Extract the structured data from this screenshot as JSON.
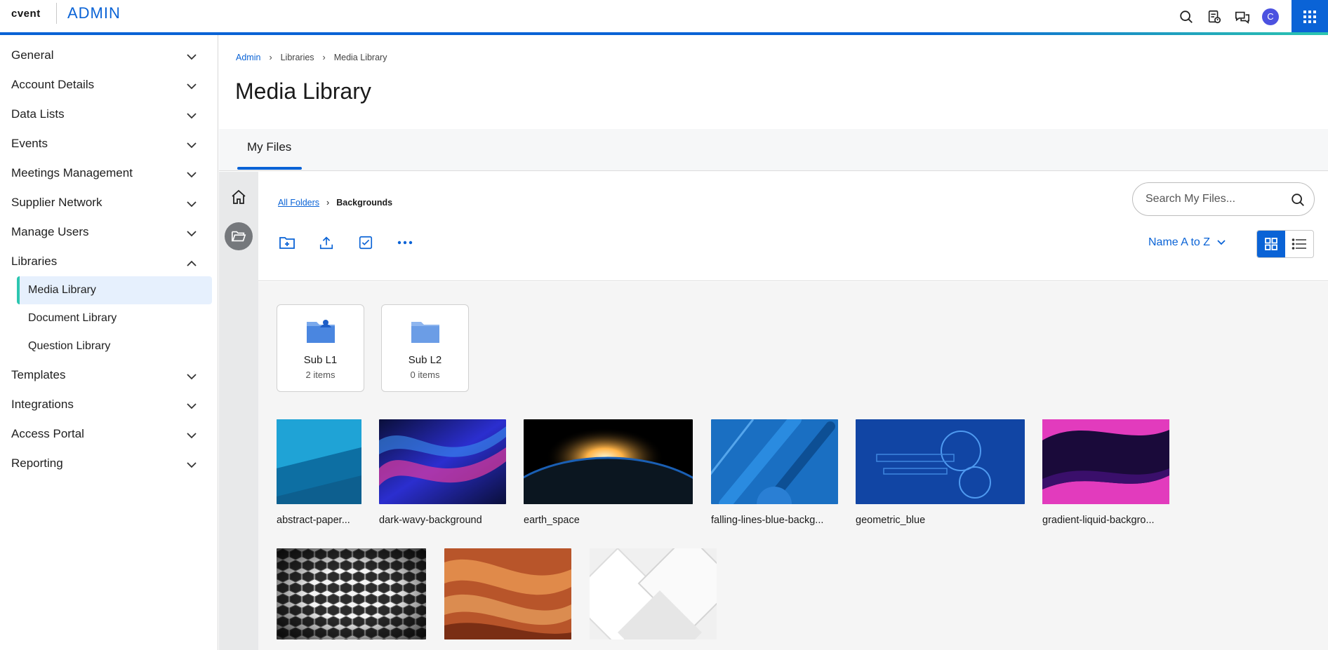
{
  "app": {
    "logo": "cvent",
    "title": "ADMIN"
  },
  "header": {
    "icons": [
      "search-icon",
      "calendar-list-icon",
      "chat-icon"
    ],
    "avatar_initial": "C"
  },
  "sidebar": {
    "items": [
      {
        "label": "General",
        "expanded": false
      },
      {
        "label": "Account Details",
        "expanded": false
      },
      {
        "label": "Data Lists",
        "expanded": false
      },
      {
        "label": "Events",
        "expanded": false
      },
      {
        "label": "Meetings Management",
        "expanded": false
      },
      {
        "label": "Supplier Network",
        "expanded": false
      },
      {
        "label": "Manage Users",
        "expanded": false
      },
      {
        "label": "Libraries",
        "expanded": true
      },
      {
        "label": "Templates",
        "expanded": false
      },
      {
        "label": "Integrations",
        "expanded": false
      },
      {
        "label": "Access Portal",
        "expanded": false
      },
      {
        "label": "Reporting",
        "expanded": false
      }
    ],
    "libraries_children": [
      {
        "label": "Media Library",
        "active": true
      },
      {
        "label": "Document Library",
        "active": false
      },
      {
        "label": "Question Library",
        "active": false
      }
    ]
  },
  "breadcrumb": [
    "Admin",
    "Libraries",
    "Media Library"
  ],
  "page_title": "Media Library",
  "tabs": [
    {
      "label": "My Files",
      "active": true
    }
  ],
  "folder_breadcrumb": {
    "root": "All Folders",
    "current": "Backgrounds"
  },
  "search": {
    "placeholder": "Search My Files..."
  },
  "sort": {
    "label": "Name A to Z"
  },
  "view_mode": "grid",
  "folders": [
    {
      "name": "Sub L1",
      "count": "2 items",
      "has_content": true
    },
    {
      "name": "Sub L2",
      "count": "0 items",
      "has_content": false
    }
  ],
  "images": [
    {
      "name": "abstract-paper...",
      "colors": [
        "#0a7fb8",
        "#1fa3d6",
        "#0d5f8f"
      ]
    },
    {
      "name": "dark-wavy-background",
      "colors": [
        "#2b2ecf",
        "#e03aa0",
        "#0a0f3a"
      ]
    },
    {
      "name": "earth_space",
      "colors": [
        "#000000",
        "#ffb347",
        "#1a5fb4"
      ]
    },
    {
      "name": "falling-lines-blue-backg...",
      "colors": [
        "#1a6fc2",
        "#2a8be0",
        "#0d4f94"
      ]
    },
    {
      "name": "geometric_blue",
      "colors": [
        "#0b2f8a",
        "#1d6fd4",
        "#0a1c5c"
      ]
    },
    {
      "name": "gradient-liquid-backgro...",
      "colors": [
        "#1a0a3a",
        "#e23bbd",
        "#3a0f6b"
      ]
    },
    {
      "name": "",
      "colors": [
        "#2b2b2b",
        "#555555",
        "#111111"
      ]
    },
    {
      "name": "",
      "colors": [
        "#b8552a",
        "#e08a4a",
        "#7a2e14"
      ]
    },
    {
      "name": "",
      "colors": [
        "#f0f0f0",
        "#dcdcdc",
        "#ffffff"
      ]
    }
  ]
}
